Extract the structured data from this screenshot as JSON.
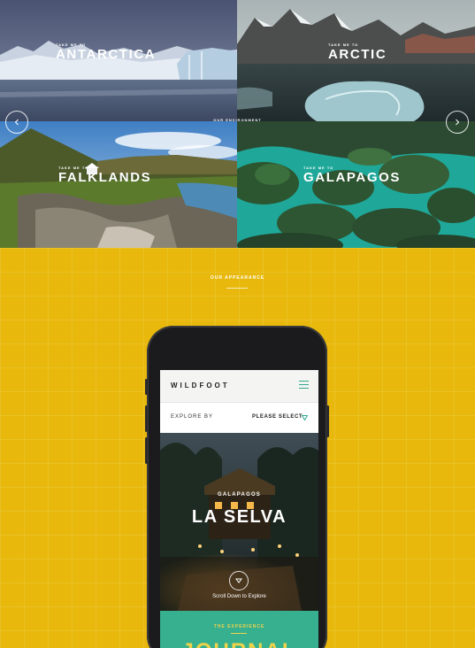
{
  "destinations": {
    "center_tag": "OUR ENVIRONMENT",
    "tiles": [
      {
        "kicker": "TAKE ME TO",
        "name": "ANTARCTICA"
      },
      {
        "kicker": "TAKE ME TO",
        "name": "ARCTIC"
      },
      {
        "kicker": "TAKE ME TO",
        "name": "FALKLANDS"
      },
      {
        "kicker": "TAKE ME TO",
        "name": "GALAPAGOS"
      }
    ],
    "prev_icon": "chevron-left-icon",
    "next_icon": "chevron-right-icon"
  },
  "appearance": {
    "title": "OUR APPEARANCE"
  },
  "mobile": {
    "brand": "WILDFOOT",
    "menu_icon": "hamburger-icon",
    "explore_label": "EXPLORE BY",
    "select_label": "PLEASE SELECT",
    "hero": {
      "kicker": "GALAPAGOS",
      "title": "LA SELVA",
      "scroll_text": "Scroll Down to Explore"
    },
    "experience": {
      "kicker": "THE EXPERIENCE",
      "title": "JOURNAL"
    }
  },
  "colors": {
    "yellow": "#e8b90c",
    "teal": "#36b08f",
    "accent_yellow": "#f0d24b"
  }
}
